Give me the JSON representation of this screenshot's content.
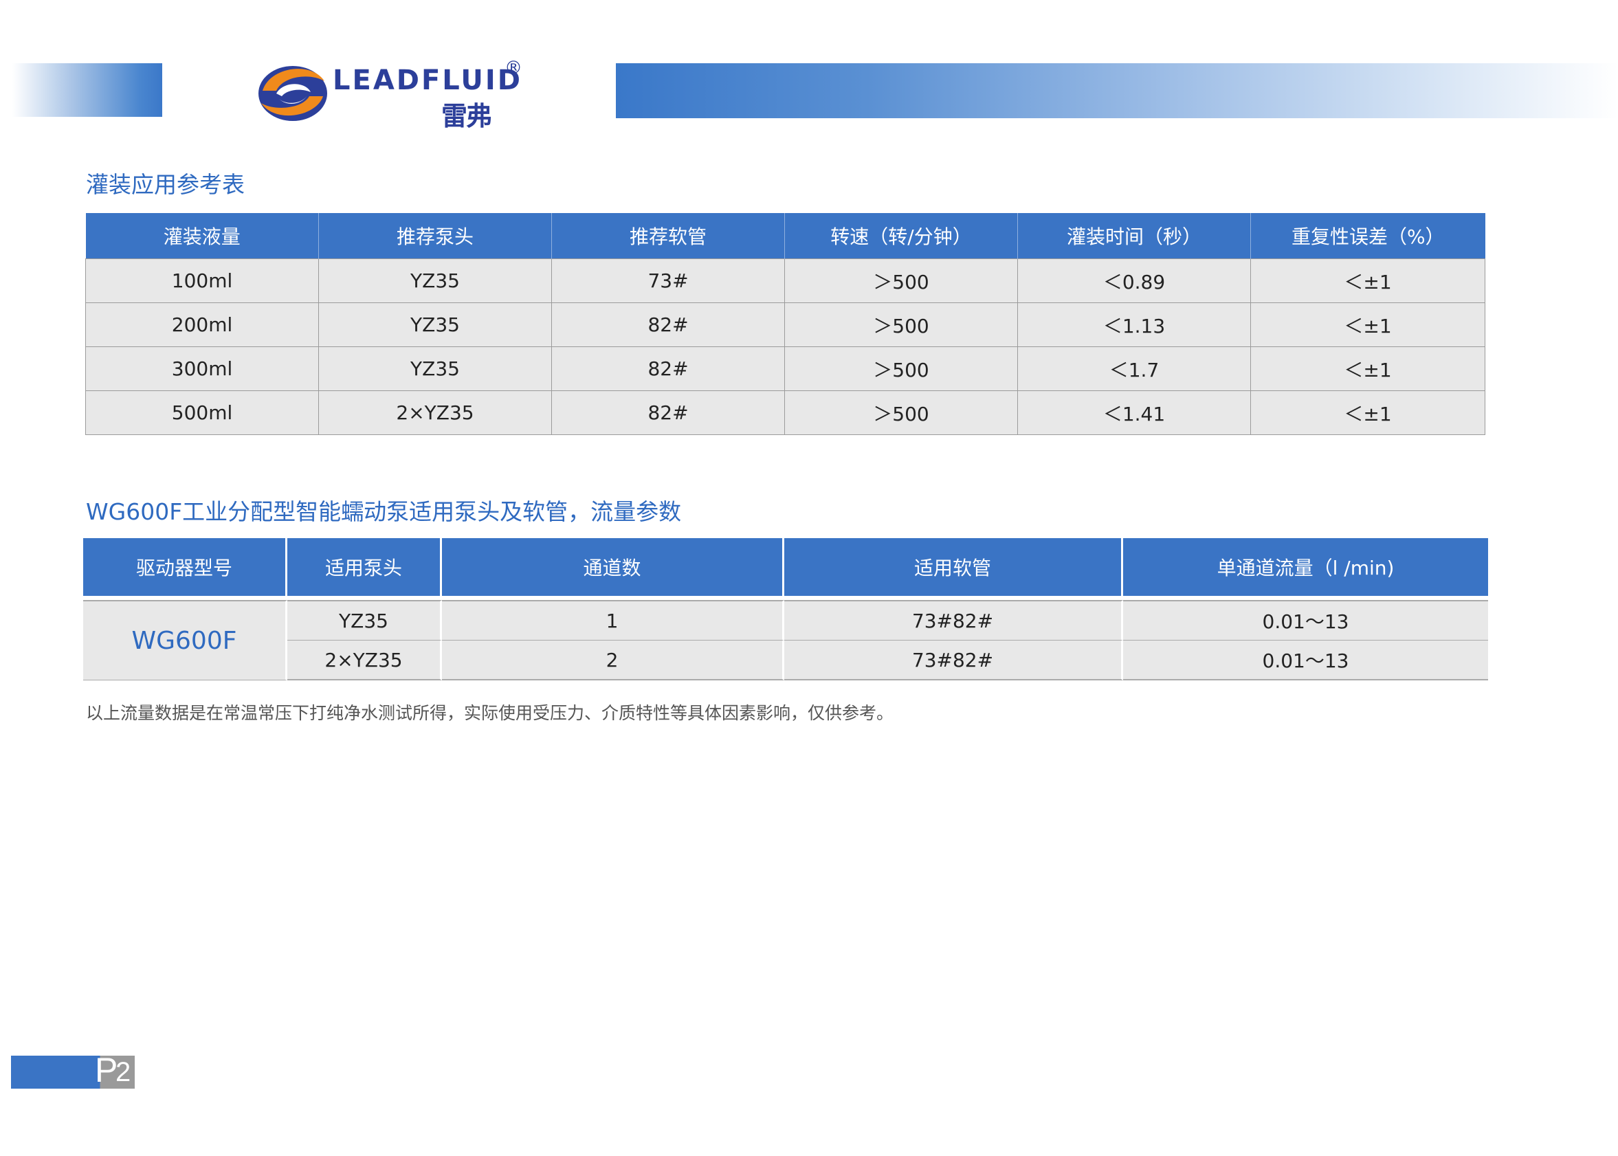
{
  "header": {
    "brand_en": "LEADFLUID",
    "brand_reg": "®",
    "brand_cn": "雷弗"
  },
  "section1": {
    "title": "灌装应用参考表",
    "columns": [
      "灌装液量",
      "推荐泵头",
      "推荐软管",
      "转速（转/分钟）",
      "灌装时间（秒）",
      "重复性误差（%）"
    ],
    "rows": [
      [
        "100ml",
        "YZ35",
        "73#",
        "＞500",
        "＜0.89",
        "＜±1"
      ],
      [
        "200ml",
        "YZ35",
        "82#",
        "＞500",
        "＜1.13",
        "＜±1"
      ],
      [
        "300ml",
        "YZ35",
        "82#",
        "＞500",
        "＜1.7",
        "＜±1"
      ],
      [
        "500ml",
        "2×YZ35",
        "82#",
        "＞500",
        "＜1.41",
        "＜±1"
      ]
    ]
  },
  "section2": {
    "title": "WG600F工业分配型智能蠕动泵适用泵头及软管，流量参数",
    "columns": [
      "驱动器型号",
      "适用泵头",
      "通道数",
      "适用软管",
      "单通道流量（l /min)"
    ],
    "model": "WG600F",
    "rows": [
      [
        "YZ35",
        "1",
        "73#82#",
        "0.01～13"
      ],
      [
        "2×YZ35",
        "2",
        "73#82#",
        "0.01～13"
      ]
    ]
  },
  "note": "以上流量数据是在常温常压下打纯净水测试所得，实际使用受压力、介质特性等具体因素影响，仅供参考。",
  "page": {
    "letter": "P",
    "number": "2"
  },
  "colors": {
    "accent": "#3a74c5",
    "title": "#2f6ac0",
    "row_bg": "#e8e8e8",
    "brand": "#2c3f9a",
    "logo_orange": "#f08a1c"
  }
}
